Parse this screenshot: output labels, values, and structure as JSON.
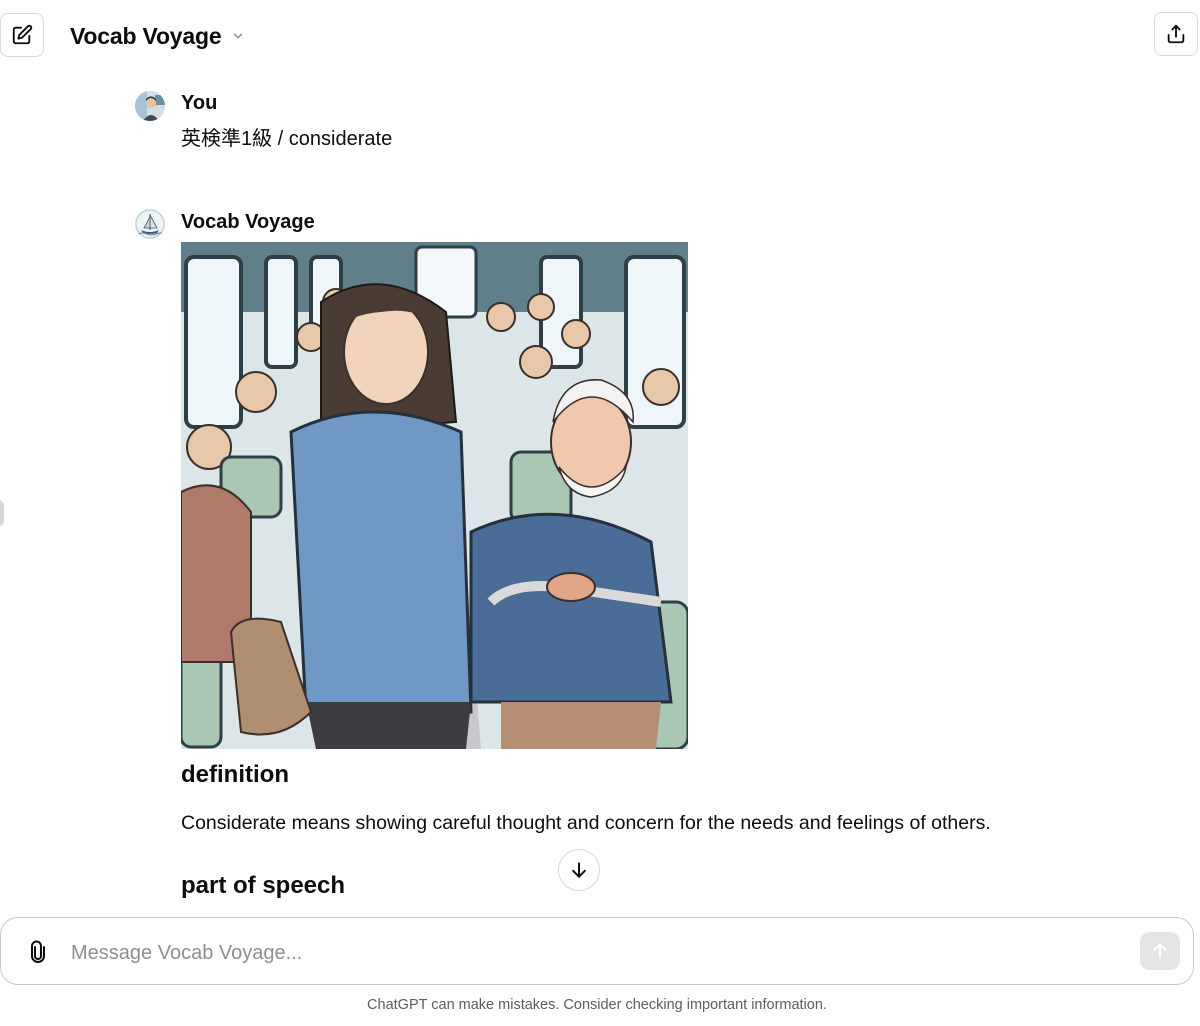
{
  "header": {
    "title": "Vocab Voyage",
    "icons": {
      "new_chat": "edit-icon",
      "dropdown": "chevron-down-icon",
      "share": "share-icon"
    }
  },
  "messages": {
    "user": {
      "author": "You",
      "text": "英検準1級 / considerate"
    },
    "assistant": {
      "author": "Vocab Voyage",
      "sections": {
        "definition_heading": "definition",
        "definition_text": "Considerate means showing careful thought and concern for the needs and feelings of others.",
        "pos_heading": "part of speech"
      }
    }
  },
  "composer": {
    "placeholder": "Message Vocab Voyage...",
    "value": "",
    "icons": {
      "attach": "paperclip-icon",
      "send": "arrow-up-icon"
    }
  },
  "scroll_button_icon": "arrow-down-icon",
  "footer": {
    "disclaimer": "ChatGPT can make mistakes. Consider checking important information."
  },
  "colors": {
    "text": "#0d0d0d",
    "muted": "#8e8e8e",
    "border": "#d9d9d9",
    "send_disabled": "#e5e5e5"
  }
}
